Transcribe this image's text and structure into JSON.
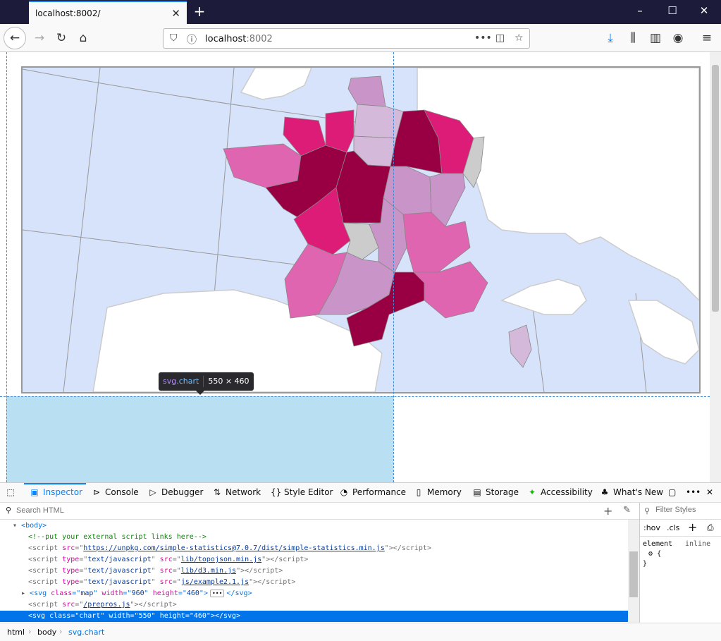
{
  "browser": {
    "tab_title": "localhost:8002/",
    "url_host": "localhost",
    "url_port": ":8002"
  },
  "devtools": {
    "tabs": [
      "Inspector",
      "Console",
      "Debugger",
      "Network",
      "Style Editor",
      "Performance",
      "Memory",
      "Storage",
      "Accessibility",
      "What's New"
    ],
    "search_placeholder": "Search HTML",
    "filter_placeholder": "Filter Styles",
    "hov": ":hov",
    "cls": ".cls",
    "rule_selector": "element",
    "rule_source": "inline",
    "rule_open": "{",
    "rule_close": "}",
    "breadcrumbs": [
      "html",
      "body",
      "svg.chart"
    ],
    "markup": {
      "body": "<body>",
      "comment": "<!--put your external script links here-->",
      "script1_src": "https://unpkg.com/simple-statistics@7.0.7/dist/simple-statistics.min.js",
      "script2_src": "lib/topojson.min.js",
      "script3_src": "lib/d3.min.js",
      "script4_src": "js/example2.1.js",
      "svg_map_class": "map",
      "svg_map_width": "960",
      "svg_map_height": "460",
      "script5_src": "/prepros.js",
      "svg_chart_class": "chart",
      "svg_chart_width": "550",
      "svg_chart_height": "460"
    }
  },
  "highlighter": {
    "tag": "svg",
    "cls": ".chart",
    "size": "550 × 460"
  },
  "map_colors": {
    "sea": "#d6e3fb",
    "land": "#ffffff",
    "border": "#cccccc",
    "class_darkest": "#980043",
    "class_dark": "#dd1c77",
    "class_mid": "#df65b0",
    "class_light": "#c994c7",
    "class_lightest": "#d4b9da",
    "no_data": "#cccccc"
  }
}
